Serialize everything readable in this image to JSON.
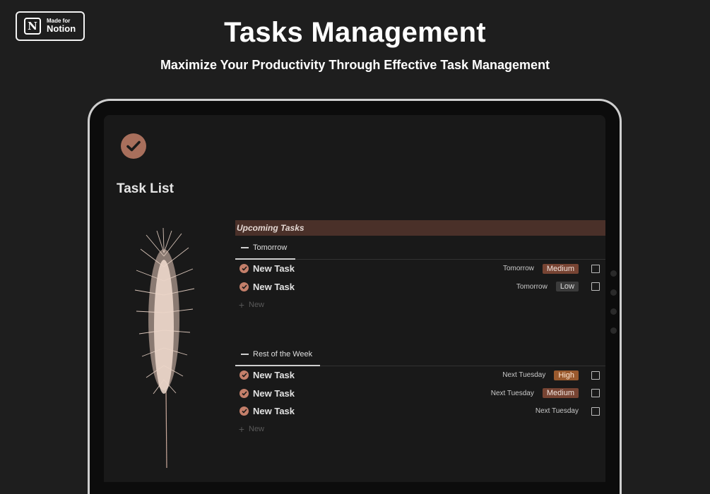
{
  "badge": {
    "small": "Made for",
    "big": "Notion",
    "logo": "N"
  },
  "header": {
    "title": "Tasks Management",
    "subtitle": "Maximize Your Productivity Through Effective Task Management"
  },
  "page": {
    "title": "Task List",
    "icon": "checkmark-circle-icon"
  },
  "database": {
    "title": "Upcoming Tasks",
    "groups": [
      {
        "label": "Tomorrow",
        "tasks": [
          {
            "name": "New Task",
            "date": "Tomorrow",
            "priority": "Medium"
          },
          {
            "name": "New Task",
            "date": "Tomorrow",
            "priority": "Low"
          }
        ],
        "new_label": "New"
      },
      {
        "label": "Rest of the Week",
        "tasks": [
          {
            "name": "New Task",
            "date": "Next Tuesday",
            "priority": "High"
          },
          {
            "name": "New Task",
            "date": "Next Tuesday",
            "priority": "Medium"
          },
          {
            "name": "New Task",
            "date": "Next Tuesday",
            "priority": ""
          }
        ],
        "new_label": "New"
      }
    ]
  },
  "colors": {
    "background": "#1e1e1e",
    "accent": "#c47f6a",
    "header_bar": "#4a3029",
    "medium": "#774433",
    "low": "#3b3b3b",
    "high": "#9a5a2e"
  }
}
